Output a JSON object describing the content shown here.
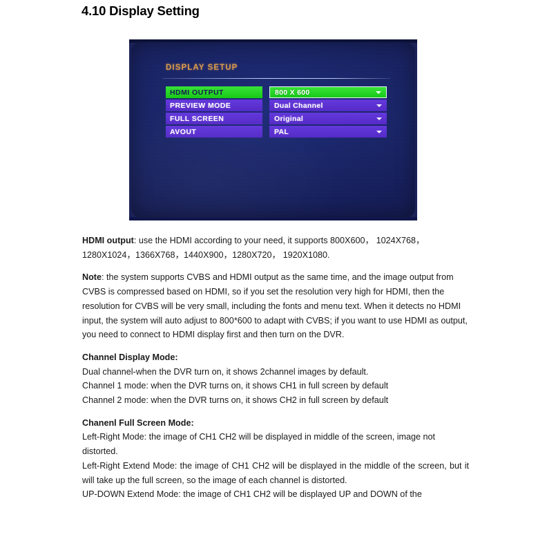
{
  "heading": "4.10 Display Setting",
  "osd": {
    "title": "DISPLAY SETUP",
    "rows": [
      {
        "label": "HDMI OUTPUT",
        "value": "800 X 600",
        "selected": true
      },
      {
        "label": "PREVIEW MODE",
        "value": "Dual Channel",
        "selected": false
      },
      {
        "label": "FULL SCREEN",
        "value": "Original",
        "selected": false
      },
      {
        "label": "AVOUT",
        "value": "PAL",
        "selected": false
      }
    ],
    "colors": {
      "screen_background": "#141f62",
      "title_text": "#d8994b",
      "row_purple": "#5a2fd0",
      "row_highlight_green": "#22d422",
      "row_text": "#ffffff"
    }
  },
  "content": {
    "hdmi_label": "HDMI output",
    "hdmi_body": ": use the HDMI according to your need, it supports 800X600，  1024X768，1280X1024，1366X768，1440X900，1280X720，  1920X1080.",
    "note_label": "Note",
    "note_body": ": the system supports CVBS and HDMI output as the same time, and the image output from CVBS is compressed based on HDMI, so if you set the resolution very high for HDMI, then the resolution for CVBS will be very small, including the fonts and menu text. When it detects no HDMI input, the system will auto adjust to 800*600 to adapt with CVBS; if you want to use HDMI as output, you need to connect to HDMI display first and then turn on the DVR.",
    "channel_display_heading": "Channel Display Mode:",
    "channel_display_line1": "Dual channel-when the DVR turn on, it shows 2channel images by default.",
    "channel_display_line2": "Channel 1 mode: when the DVR turns on, it shows CH1 in full screen by default",
    "channel_display_line3": "Channel 2 mode: when the DVR turns on, it shows CH2 in full screen by default",
    "full_screen_heading": "Chanenl Full Screen Mode:",
    "full_screen_line1": "Left-Right Mode: the image of CH1 CH2 will be displayed in middle of the screen, image not distorted.",
    "full_screen_line2": "Left-Right Extend Mode: the image of CH1 CH2 will be displayed in the middle of the screen, but it will take up the full screen, so the image of each channel is distorted.",
    "full_screen_line3": "UP-DOWN Extend Mode: the image of CH1 CH2 will be displayed UP and DOWN of the"
  }
}
